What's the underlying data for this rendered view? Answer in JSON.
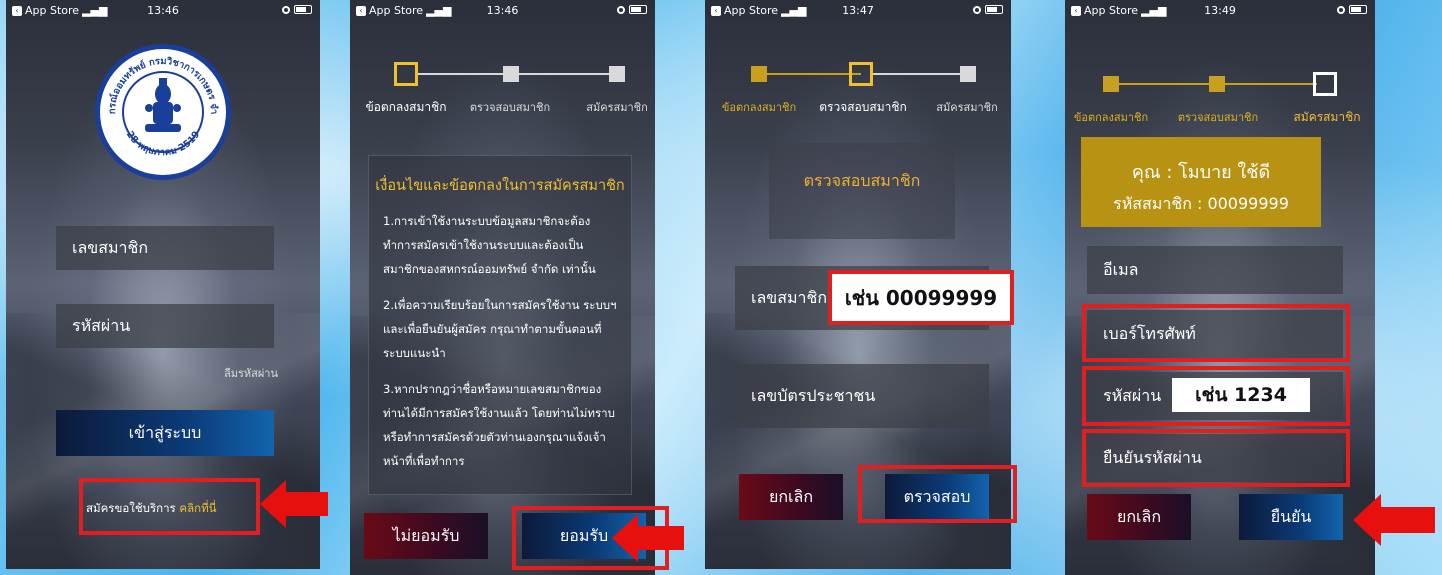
{
  "status_bar": [
    {
      "carrier": "App Store",
      "time": "13:46"
    },
    {
      "carrier": "App Store",
      "time": "13:46"
    },
    {
      "carrier": "App Store",
      "time": "13:47"
    },
    {
      "carrier": "App Store",
      "time": "13:49"
    }
  ],
  "screen1": {
    "logo_text_top": "สหกรณ์ออมทรัพย์ กรมวิชาการเกษตร จำกัด",
    "logo_text_bottom": "28 พฤษภาคม 2519",
    "member_id_placeholder": "เลขสมาชิก",
    "password_placeholder": "รหัสผ่าน",
    "forgot_password": "ลืมรหัสผ่าน",
    "login_button": "เข้าสู่ระบบ",
    "register_prompt": "สมัครขอใช้บริการ",
    "register_link": "คลิกที่นี่"
  },
  "steps": [
    "ข้อตกลงสมาชิก",
    "ตรวจสอบสมาชิก",
    "สมัครสมาชิก"
  ],
  "screen2": {
    "terms_title": "เงื่อนไขและข้อตกลงในการสมัครสมาชิก",
    "terms": [
      "1.การเข้าใช้งานระบบข้อมูลสมาชิกจะต้องทำการสมัครเข้าใช้งานระบบและต้องเป็นสมาชิกของสหกรณ์ออมทรัพย์ จำกัด เท่านั้น",
      "2.เพื่อความเรียบร้อยในการสมัครใช้งาน ระบบฯ และเพื่อยืนยันผู้สมัคร กรุณาทำตามขั้นตอนที่ระบบแนะนำ",
      "3.หากปรากฎว่าชื่อหรือหมายเลขสมาชิกของท่านได้มีการสมัครใช้งานแล้ว โดยท่านไม่ทราบ หรือทำการสมัครด้วยตัวท่านเองกรุณาแจ้งเจ้าหน้าที่เพื่อทำการ"
    ],
    "decline_button": "ไม่ยอมรับ",
    "accept_button": "ยอมรับ"
  },
  "screen3": {
    "title": "ตรวจสอบสมาชิก",
    "member_id_label": "เลขสมาชิก",
    "member_id_example": "เช่น 00099999",
    "citizen_id_label": "เลขบัตรประชาชน",
    "cancel_button": "ยกเลิก",
    "verify_button": "ตรวจสอบ"
  },
  "screen4": {
    "name_line": "คุณ : โมบาย ใช้ดี",
    "member_line": "รหัสสมาชิก : 00099999",
    "email_label": "อีเมล",
    "phone_label": "เบอร์โทรศัพท์",
    "password_label": "รหัสผ่าน",
    "password_example": "เช่น 1234",
    "confirm_password_label": "ยืนยันรหัสผ่าน",
    "cancel_button": "ยกเลิก",
    "confirm_button": "ยืนยัน"
  },
  "colors": {
    "highlight": "#e02020",
    "gold": "#c8a020",
    "link": "#f0c030",
    "button_blue": "#0b3b78",
    "button_red": "#6a0a18"
  }
}
